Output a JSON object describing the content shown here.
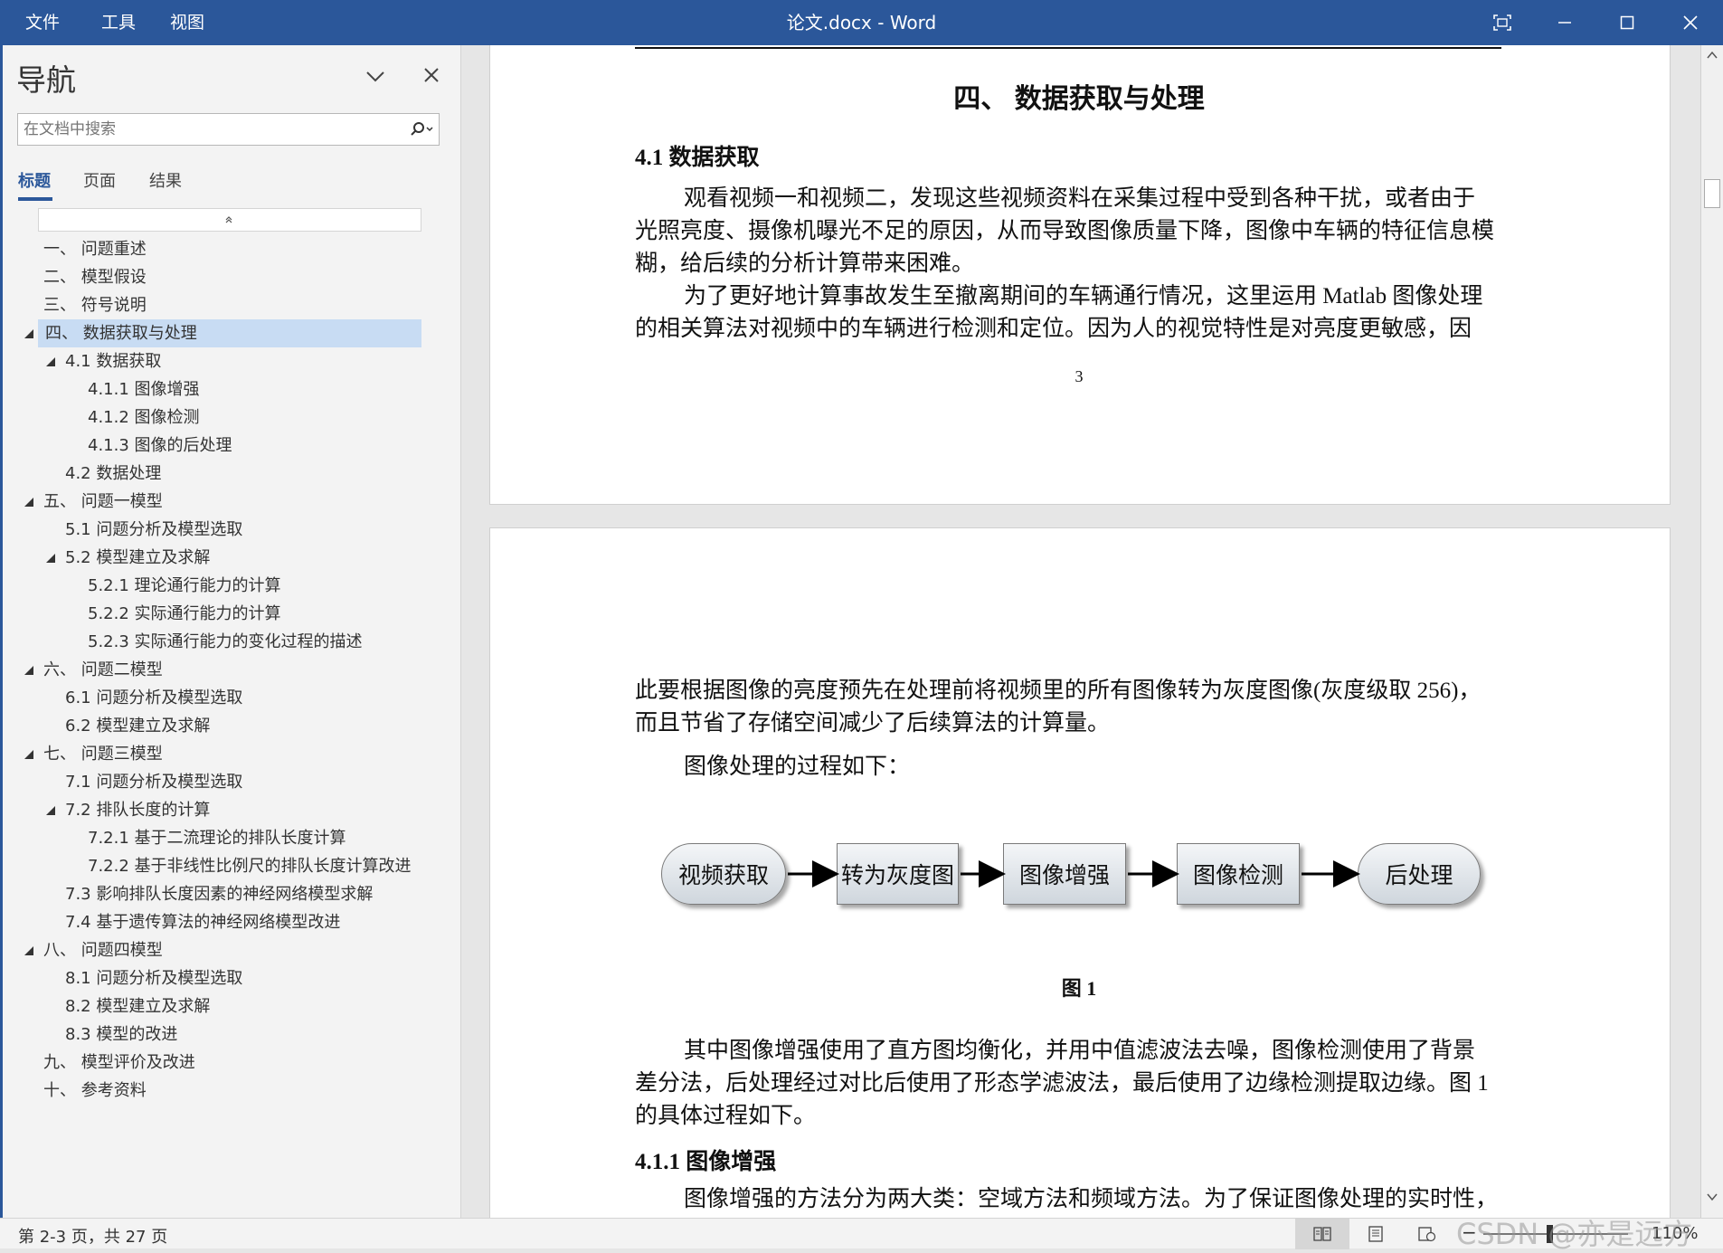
{
  "titlebar": {
    "menus": [
      "文件",
      "工具",
      "视图"
    ],
    "title": "论文.docx  -  Word"
  },
  "nav": {
    "title": "导航",
    "search_placeholder": "在文档中搜索",
    "tabs": [
      "标题",
      "页面",
      "结果"
    ],
    "headings": [
      {
        "label": "一、 问题重述"
      },
      {
        "label": "二、 模型假设"
      },
      {
        "label": "三、 符号说明"
      },
      {
        "label": "四、 数据获取与处理"
      },
      {
        "label": "4.1 数据获取"
      },
      {
        "label": "4.1.1 图像增强"
      },
      {
        "label": "4.1.2 图像检测"
      },
      {
        "label": "4.1.3 图像的后处理"
      },
      {
        "label": "4.2 数据处理"
      },
      {
        "label": "五、 问题一模型"
      },
      {
        "label": "5.1 问题分析及模型选取"
      },
      {
        "label": "5.2 模型建立及求解"
      },
      {
        "label": "5.2.1 理论通行能力的计算"
      },
      {
        "label": "5.2.2 实际通行能力的计算"
      },
      {
        "label": "5.2.3 实际通行能力的变化过程的描述"
      },
      {
        "label": "六、 问题二模型"
      },
      {
        "label": "6.1 问题分析及模型选取"
      },
      {
        "label": "6.2 模型建立及求解"
      },
      {
        "label": "七、 问题三模型"
      },
      {
        "label": "7.1 问题分析及模型选取"
      },
      {
        "label": "7.2 排队长度的计算"
      },
      {
        "label": "7.2.1 基于二流理论的排队长度计算"
      },
      {
        "label": "7.2.2 基于非线性比例尺的排队长度计算改进"
      },
      {
        "label": "7.3 影响排队长度因素的神经网络模型求解"
      },
      {
        "label": "7.4 基于遗传算法的神经网络模型改进"
      },
      {
        "label": "八、 问题四模型"
      },
      {
        "label": "8.1 问题分析及模型选取"
      },
      {
        "label": "8.2 模型建立及求解"
      },
      {
        "label": "8.3 模型的改进"
      },
      {
        "label": "九、 模型评价及改进"
      },
      {
        "label": "十、 参考资料"
      }
    ]
  },
  "document": {
    "page1": {
      "heading": "四、  数据获取与处理",
      "subheading": "4.1 数据获取",
      "para1_lines": [
        "观看视频一和视频二，发现这些视频资料在采集过程中受到各种干扰，或者由于",
        "光照亮度、摄像机曝光不足的原因，从而导致图像质量下降，图像中车辆的特征信息模",
        "糊，给后续的分析计算带来困难。"
      ],
      "para2_lines": [
        "为了更好地计算事故发生至撤离期间的车辆通行情况，这里运用 Matlab 图像处理",
        "的相关算法对视频中的车辆进行检测和定位。因为人的视觉特性是对亮度更敏感，因"
      ],
      "page_number": "3"
    },
    "page2": {
      "para1_lines": [
        "此要根据图像的亮度预先在处理前将视频里的所有图像转为灰度图像(灰度级取 256)，",
        "而且节省了存储空间减少了后续算法的计算量。"
      ],
      "para2": "图像处理的过程如下：",
      "flow": [
        "视频获取",
        "转为灰度图",
        "图像增强",
        "图像检测",
        "后处理"
      ],
      "figure_caption": "图  1",
      "para3_lines": [
        "其中图像增强使用了直方图均衡化，并用中值滤波法去噪，图像检测使用了背景",
        "差分法，后处理经过对比后使用了形态学滤波法，最后使用了边缘检测提取边缘。图  1",
        "的具体过程如下。"
      ],
      "subheading": "4.1.1 图像增强",
      "para4": "图像增强的方法分为两大类：空域方法和频域方法。为了保证图像处理的实时性，"
    }
  },
  "statusbar": {
    "page_info": "第 2-3 页，共 27 页",
    "zoom": "110%",
    "zoom_minus": "−",
    "watermark": "CSDN @亦是远方"
  }
}
